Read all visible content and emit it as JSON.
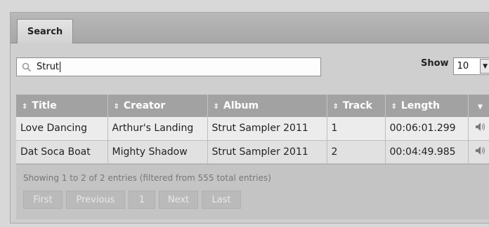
{
  "tabs": [
    {
      "label": "Search"
    }
  ],
  "search": {
    "value": "Strut",
    "icon": "search-icon"
  },
  "show": {
    "label": "Show",
    "value": "10"
  },
  "table": {
    "columns": [
      "Title",
      "Creator",
      "Album",
      "Track",
      "Length"
    ],
    "rows": [
      {
        "title": "Love Dancing",
        "creator": "Arthur's Landing",
        "album": "Strut Sampler 2011",
        "track": "1",
        "length": "00:06:01.299",
        "icon": "speaker-icon"
      },
      {
        "title": "Dat Soca Boat",
        "creator": "Mighty Shadow",
        "album": "Strut Sampler 2011",
        "track": "2",
        "length": "00:04:49.985",
        "icon": "speaker-icon"
      }
    ]
  },
  "info": "Showing 1 to 2 of 2 entries (filtered from 555 total entries)",
  "pagination": {
    "first": "First",
    "previous": "Previous",
    "page": "1",
    "next": "Next",
    "last": "Last"
  }
}
